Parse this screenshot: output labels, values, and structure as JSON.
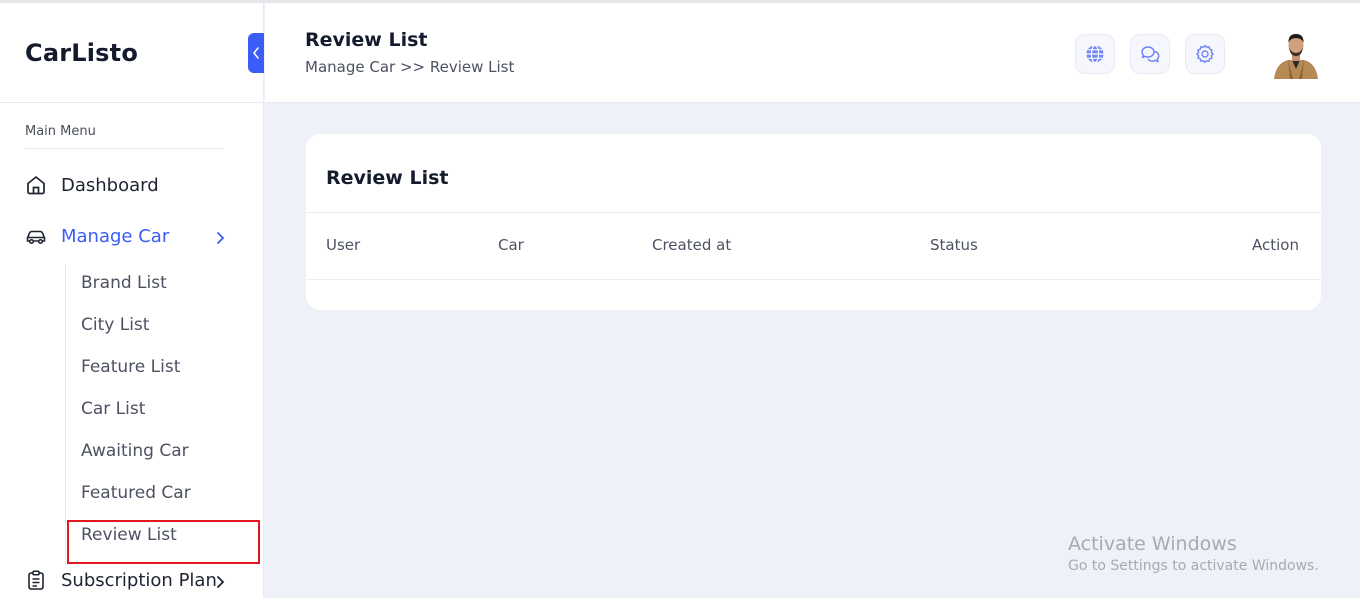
{
  "brand": "CarListo",
  "sidebar": {
    "menu_heading": "Main Menu",
    "items": [
      {
        "label": "Dashboard",
        "icon": "home-icon"
      },
      {
        "label": "Manage Car",
        "icon": "car-icon"
      },
      {
        "label": "Subscription Plan",
        "icon": "clipboard-icon"
      }
    ],
    "submenu": [
      {
        "label": "Brand List"
      },
      {
        "label": "City List"
      },
      {
        "label": "Feature List"
      },
      {
        "label": "Car List"
      },
      {
        "label": "Awaiting Car"
      },
      {
        "label": "Featured Car"
      },
      {
        "label": "Review List"
      }
    ],
    "active_item": "Review List"
  },
  "header": {
    "title": "Review List",
    "breadcrumb": "Manage Car >> Review List",
    "icons": [
      "globe-icon",
      "chat-icon",
      "gear-icon"
    ]
  },
  "card": {
    "title": "Review List",
    "columns": [
      "User",
      "Car",
      "Created at",
      "Status",
      "Action"
    ],
    "rows": []
  },
  "watermark": {
    "title": "Activate Windows",
    "subtitle": "Go to Settings to activate Windows."
  },
  "colors": {
    "accent": "#3b5cf6",
    "highlight_border": "#e3171e",
    "background": "#eef1f7"
  }
}
